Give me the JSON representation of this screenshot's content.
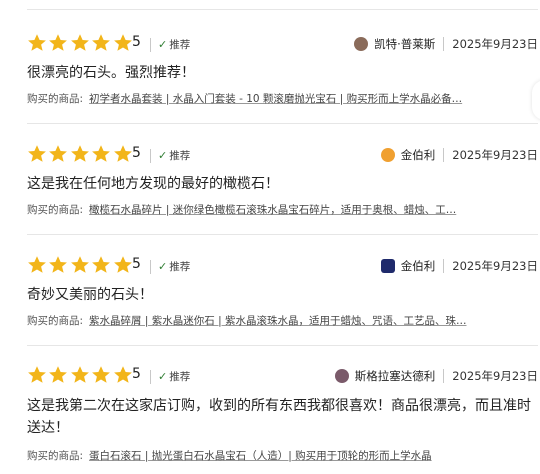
{
  "reviews": [
    {
      "score": "5",
      "recommend": "推荐",
      "author": "凯特·普莱斯",
      "avatar_color": "#8a6b5a",
      "date": "2025年9月23日",
      "text": "很漂亮的石头。强烈推荐！",
      "product_label": "购买的商品:",
      "product": "初学者水晶套装 | 水晶入门套装 - 10 颗滚磨抛光宝石 | 购买形而上学水晶必备…"
    },
    {
      "score": "5",
      "recommend": "推荐",
      "author": "金伯利",
      "avatar_color": "#f0a030",
      "date": "2025年9月23日",
      "text": "这是我在任何地方发现的最好的橄榄石！",
      "product_label": "购买的商品:",
      "product": "橄榄石水晶碎片 | 迷你绿色橄榄石滚珠水晶宝石碎片，适用于奥根、蜡烛、工…"
    },
    {
      "score": "5",
      "recommend": "推荐",
      "author": "金伯利",
      "avatar_color": "#1f2a6b",
      "date": "2025年9月23日",
      "text": "奇妙又美丽的石头！",
      "product_label": "购买的商品:",
      "product": "紫水晶碎屑 | 紫水晶迷你石 | 紫水晶滚珠水晶，适用于蜡烛、咒语、工艺品、珠…"
    },
    {
      "score": "5",
      "recommend": "推荐",
      "author": "斯格拉塞达德利",
      "avatar_color": "#7a5a6a",
      "date": "2025年9月23日",
      "text": "这是我第二次在这家店订购，收到的所有东西我都很喜欢！商品很漂亮，而且准时送达！",
      "product_label": "购买的商品:",
      "product": "蛋白石滚石 | 抛光蛋白石水晶宝石（人造）| 购买用于顶轮的形而上学水晶"
    }
  ],
  "star_color": "#f2b51a",
  "check_color": "#2f7d32"
}
